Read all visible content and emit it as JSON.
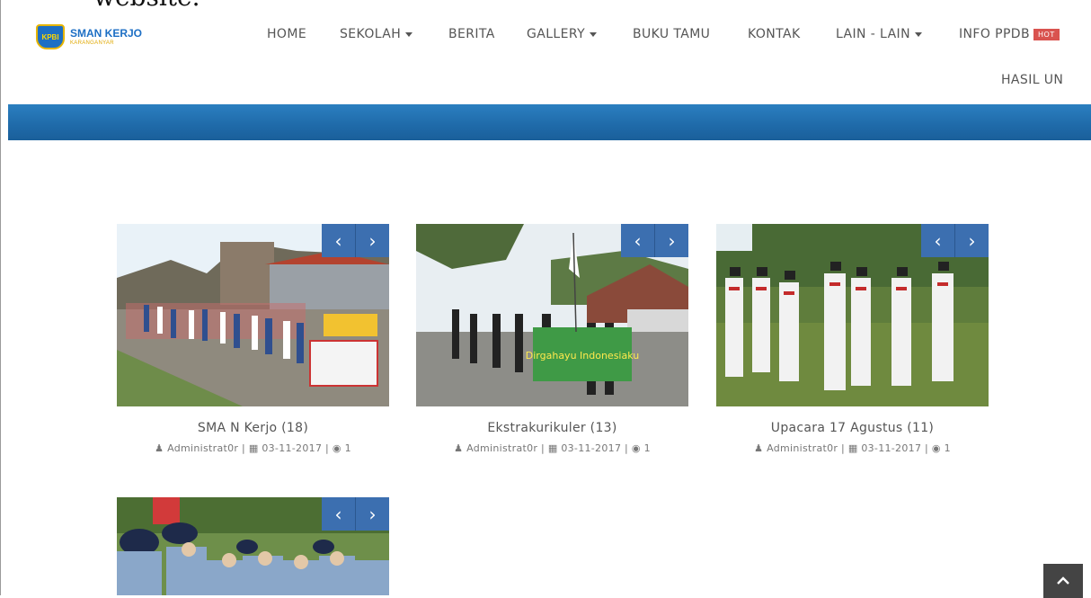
{
  "caption_fragment": "website.",
  "logo": {
    "badge": "KPBI",
    "name": "SMAN KERJO",
    "subtitle": "KARANGANYAR"
  },
  "nav": {
    "items": [
      "HOME",
      "SEKOLAH",
      "BERITA",
      "GALLERY",
      "BUKU TAMU",
      "KONTAK",
      "LAIN - LAIN",
      "INFO PPDB",
      "HASIL UN"
    ],
    "hot_badge": "HOT"
  },
  "gallery": {
    "prev_label": "‹",
    "next_label": "›",
    "cards": [
      {
        "title": "SMA N Kerjo (18)",
        "author": "Administrat0r",
        "date": "03-11-2017",
        "views": "1"
      },
      {
        "title": "Ekstrakurikuler (13)",
        "author": "Administrat0r",
        "date": "03-11-2017",
        "views": "1"
      },
      {
        "title": "Upacara 17 Agustus (11)",
        "author": "Administrat0r",
        "date": "03-11-2017",
        "views": "1"
      },
      {
        "title": "",
        "author": "",
        "date": "",
        "views": ""
      }
    ],
    "banner_text_2": "Dirgahayu Indonesiaku"
  },
  "colors": {
    "accent": "#2b7fc0",
    "nav_text": "#555555",
    "hot": "#d9534f",
    "control": "#3c6fb0"
  }
}
